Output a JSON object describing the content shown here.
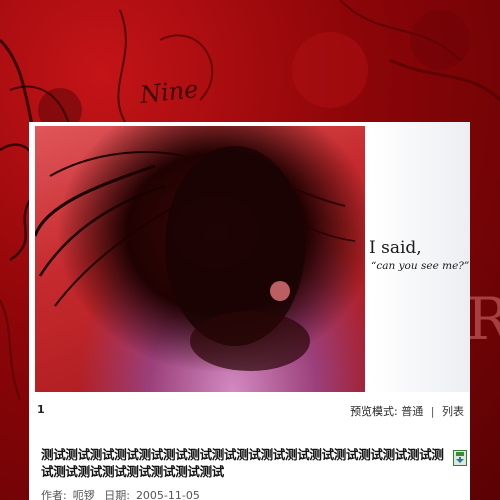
{
  "background": {
    "signature_text": "Nine",
    "side_letter": "R",
    "colors": {
      "primary": "#8d0508",
      "accent": "#c41418"
    }
  },
  "banner": {
    "quote_line1": "I said,",
    "quote_line2": "“can you see me?”"
  },
  "pager": {
    "current_page": "1",
    "view_mode_label": "预览模式:",
    "mode_normal": "普通",
    "separator": "|",
    "mode_list": "列表"
  },
  "post": {
    "title": "测试测试测试测试测试测试测试测试测试测试测试测试测试测试测试测试测试测试测试测试测试测试测试测试",
    "icon": "save-icon",
    "author_label": "作者:",
    "author": "呃锣",
    "date_label": "日期:",
    "date": "2005-11-05"
  }
}
